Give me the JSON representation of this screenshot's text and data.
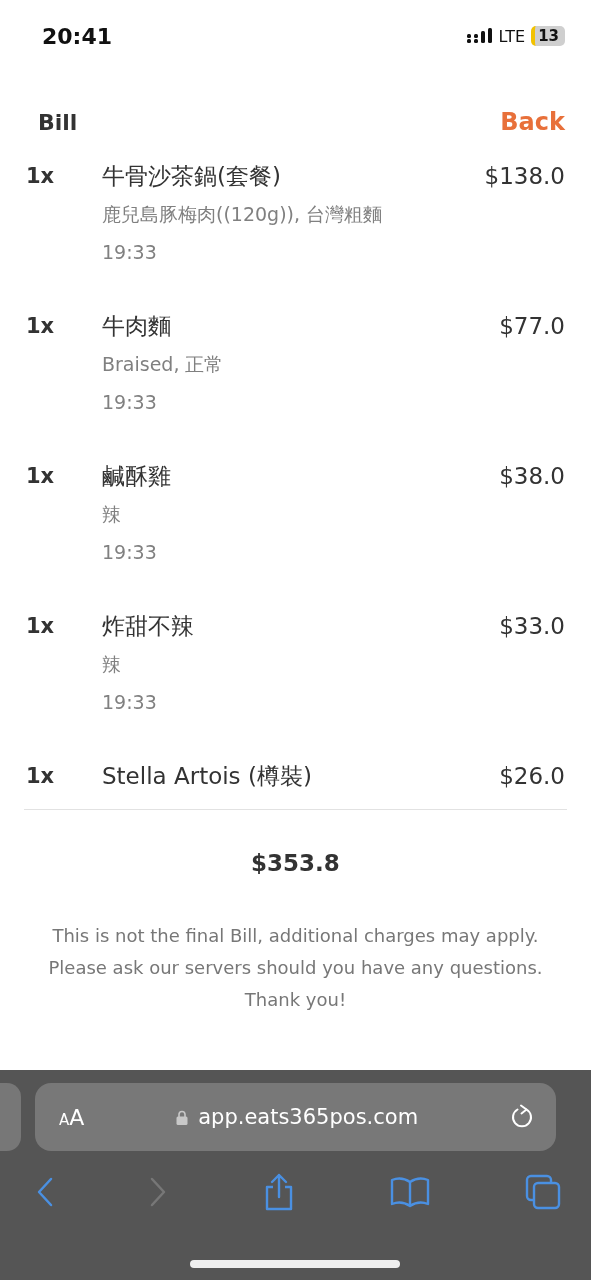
{
  "status_bar": {
    "time": "20:41",
    "network": "LTE",
    "battery": "13"
  },
  "header": {
    "title": "Bill",
    "back": "Back"
  },
  "items": [
    {
      "quantity": "1x",
      "name": "牛骨沙茶鍋(套餐)",
      "options": "鹿兒島豚梅肉((120g)), 台灣粗麵",
      "time": "19:33",
      "price": "$138.0"
    },
    {
      "quantity": "1x",
      "name": "牛肉麵",
      "options": "Braised, 正常",
      "time": "19:33",
      "price": "$77.0"
    },
    {
      "quantity": "1x",
      "name": "鹹酥雞",
      "options": "辣",
      "time": "19:33",
      "price": "$38.0"
    },
    {
      "quantity": "1x",
      "name": "炸甜不辣",
      "options": "辣",
      "time": "19:33",
      "price": "$33.0"
    },
    {
      "quantity": "1x",
      "name": "Stella Artois (樽裝)",
      "price": "$26.0"
    }
  ],
  "total": "$353.8",
  "note": [
    "This is not the final Bill, additional charges may apply.",
    "Please ask our servers should you have any questions.",
    "Thank you!"
  ],
  "browser": {
    "text_size": "AA",
    "url": "app.eats365pos.com",
    "back": {
      "disabled": false
    },
    "forward": {
      "disabled": true
    }
  }
}
